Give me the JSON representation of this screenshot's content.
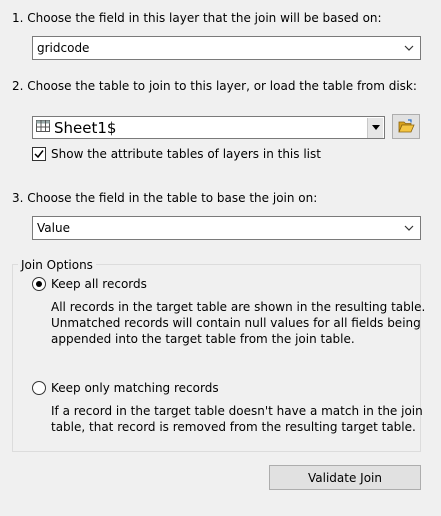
{
  "steps": {
    "step1": "1.  Choose the field in this layer that the join will be based on:",
    "step2": "2.  Choose the table to join to this layer, or load the table from disk:",
    "step3": "3.  Choose the field in the table to base the join on:"
  },
  "layer_field_select": {
    "value": "gridcode",
    "icon": "chevron-down-icon"
  },
  "table_select": {
    "value": "Sheet1$",
    "icon": "table-icon"
  },
  "browse_button": {
    "icon": "folder-open-icon"
  },
  "show_attribute_tables": {
    "label": "Show the attribute tables of layers in this list",
    "checked": true
  },
  "table_field_select": {
    "value": "Value",
    "icon": "chevron-down-icon"
  },
  "join_options": {
    "title": "Join Options",
    "keep_all": {
      "label": "Keep all records",
      "selected": true,
      "description": "All records in the target table are shown in the resulting table.\nUnmatched records will contain null values for all fields being\nappended into the target table from the join table."
    },
    "keep_matching": {
      "label": "Keep only matching records",
      "selected": false,
      "description": "If a record in the target table doesn't have a match in the join\ntable, that record is removed from the resulting target table."
    }
  },
  "validate_button": {
    "label": "Validate Join"
  }
}
